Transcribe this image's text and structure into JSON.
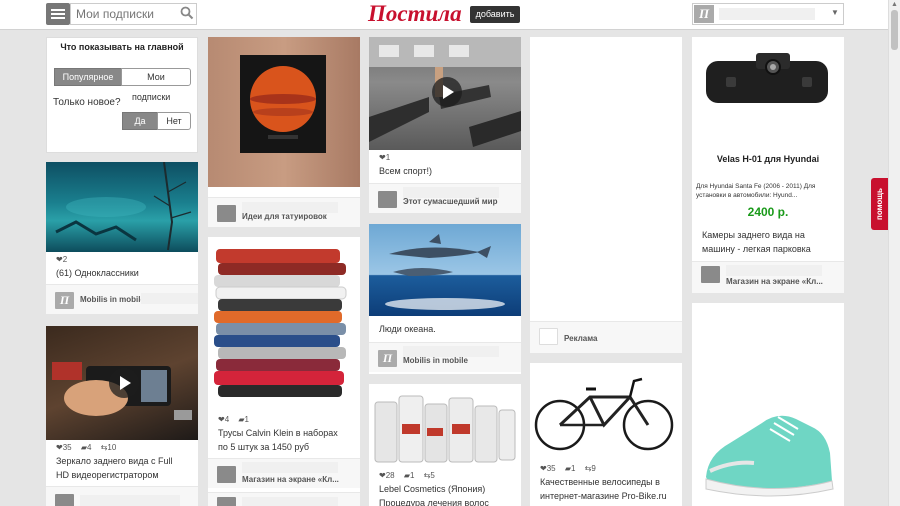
{
  "header": {
    "search_placeholder": "Мои подписки",
    "logo": "Постила",
    "add_label": "добавить",
    "user_avatar": "П"
  },
  "help_label": "помощь",
  "prefs": {
    "title": "Что показывать на главной",
    "option_popular": "Популярное",
    "option_my_line1": "Мои",
    "option_my_line2": "подписки",
    "question": "Только новое?",
    "yes": "Да",
    "no": "Нет"
  },
  "pins": {
    "underwater": {
      "likes": "2",
      "desc": "(61) Одноклассники",
      "board": "Mobilis in mobile",
      "avatar": "П"
    },
    "mirror_video": {
      "likes": "35",
      "comments": "4",
      "repins": "10",
      "desc_line1": "Зеркало заднего вида с Full",
      "desc_line2": "HD видеорегистратором"
    },
    "tattoo": {
      "board": "Идеи для татуировок"
    },
    "clothes": {
      "likes": "4",
      "comments": "1",
      "desc_line1": "Трусы Calvin Klein в наборах",
      "desc_line2": "по 5 штук за 1450 руб",
      "board": "Магазин на экране «Кл..."
    },
    "gym": {
      "likes": "1",
      "desc": "Всем спорт!)",
      "board": "Этот сумасшедший мир"
    },
    "dolphins": {
      "desc": "Люди океана.",
      "board": "Mobilis in mobile",
      "avatar": "П"
    },
    "cosmetics": {
      "likes": "28",
      "comments": "1",
      "repins": "5",
      "desc_line1": "Lebel Cosmetics (Япония)",
      "desc_line2": "Процедура лечения волос"
    },
    "ad": {
      "board": "Реклама"
    },
    "bike": {
      "likes": "35",
      "comments": "1",
      "repins": "9",
      "desc_line1": "Качественные велосипеды в",
      "desc_line2": "интернет-магазине Pro-Bike.ru"
    },
    "camera": {
      "product_name": "Velas H-01 для Hyundai",
      "product_desc_line1": "Для Hyundai Santa Fe (2006 - 2011) Для",
      "product_desc_line2": "установки в автомобили: Hyund...",
      "price": "2400 р.",
      "desc_line1": "Камеры заднего вида на",
      "desc_line2": "машину - легкая парковка",
      "board": "Магазин на экране «Кл..."
    }
  },
  "colors": {
    "brand": "#c8102e",
    "price": "#1a9a1a"
  }
}
